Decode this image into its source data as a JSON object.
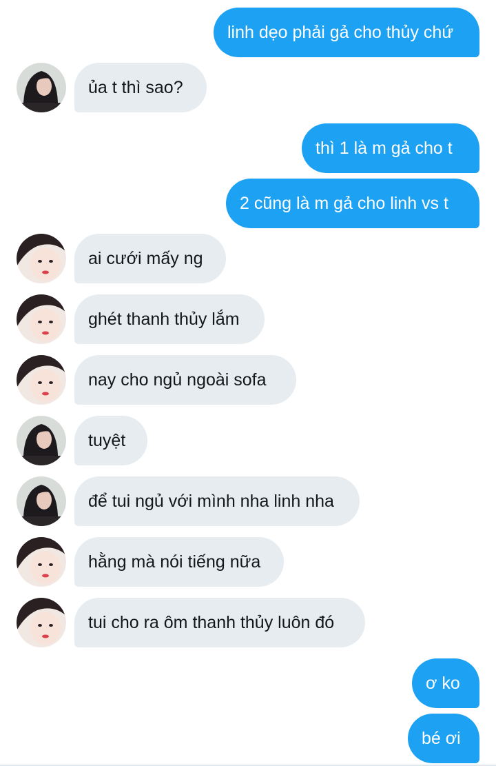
{
  "messages": [
    {
      "side": "sent",
      "text": "linh dẹo phải gả cho thủy chứ"
    },
    {
      "side": "received",
      "avatar": "dark-hair-avatar",
      "text": "ủa t thì sao?"
    },
    {
      "side": "sent",
      "text": "thì 1 là m gả cho t"
    },
    {
      "side": "sent",
      "text": "2 cũng là m gả cho linh vs t"
    },
    {
      "side": "received",
      "avatar": "light-face-avatar",
      "text": "ai cưới mấy ng"
    },
    {
      "side": "received",
      "avatar": "light-face-avatar",
      "text": "ghét thanh thủy lắm"
    },
    {
      "side": "received",
      "avatar": "light-face-avatar",
      "text": "nay cho ngủ ngoài sofa"
    },
    {
      "side": "received",
      "avatar": "dark-hair-avatar",
      "text": "tuyệt"
    },
    {
      "side": "received",
      "avatar": "dark-hair-avatar",
      "text": "để tui ngủ với mình nha linh nha"
    },
    {
      "side": "received",
      "avatar": "light-face-avatar",
      "text": "hằng mà nói tiếng nữa"
    },
    {
      "side": "received",
      "avatar": "light-face-avatar",
      "text": "tui cho ra ôm thanh thủy luôn đó"
    },
    {
      "side": "sent",
      "text": "ơ ko"
    },
    {
      "side": "sent",
      "text": "bé ơi"
    }
  ],
  "colors": {
    "sent_bubble": "#1da1f2",
    "received_bubble": "#e6ecf0",
    "sent_text": "#ffffff",
    "received_text": "#14171a"
  }
}
